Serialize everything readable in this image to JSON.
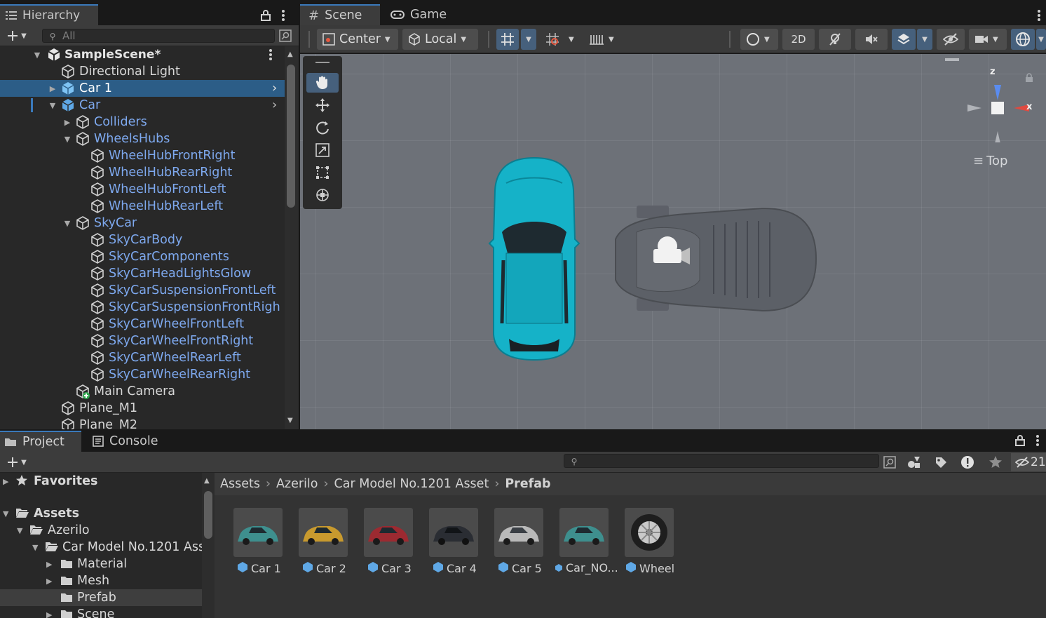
{
  "hierarchy": {
    "tab_label": "Hierarchy",
    "search_placeholder": "All",
    "scene_name": "SampleScene*",
    "items": [
      {
        "label": "Directional Light"
      },
      {
        "label": "Car 1"
      },
      {
        "label": "Car"
      },
      {
        "label": "Colliders"
      },
      {
        "label": "WheelsHubs"
      },
      {
        "label": "WheelHubFrontRight"
      },
      {
        "label": "WheelHubRearRight"
      },
      {
        "label": "WheelHubFrontLeft"
      },
      {
        "label": "WheelHubRearLeft"
      },
      {
        "label": "SkyCar"
      },
      {
        "label": "SkyCarBody"
      },
      {
        "label": "SkyCarComponents"
      },
      {
        "label": "SkyCarHeadLightsGlow"
      },
      {
        "label": "SkyCarSuspensionFrontLeft"
      },
      {
        "label": "SkyCarSuspensionFrontRigh"
      },
      {
        "label": "SkyCarWheelFrontLeft"
      },
      {
        "label": "SkyCarWheelFrontRight"
      },
      {
        "label": "SkyCarWheelRearLeft"
      },
      {
        "label": "SkyCarWheelRearRight"
      },
      {
        "label": "Main Camera"
      },
      {
        "label": "Plane_M1"
      },
      {
        "label": "Plane_M2"
      }
    ]
  },
  "scene": {
    "tab_scene": "Scene",
    "tab_game": "Game",
    "pivot": "Center",
    "space": "Local",
    "mode_2d": "2D",
    "gizmo": {
      "z": "z",
      "x": "x",
      "view": "Top"
    }
  },
  "project": {
    "tab_project": "Project",
    "tab_console": "Console",
    "hidden_count": "21",
    "tree": {
      "favorites": "Favorites",
      "assets": "Assets",
      "azerilo": "Azerilo",
      "car_model": "Car Model No.1201 Ass",
      "material": "Material",
      "mesh": "Mesh",
      "prefab": "Prefab",
      "scene": "Scene"
    },
    "breadcrumb": [
      "Assets",
      "Azerilo",
      "Car Model No.1201 Asset",
      "Prefab"
    ],
    "assets": [
      {
        "name": "Car 1",
        "color": "#3e8f8e"
      },
      {
        "name": "Car 2",
        "color": "#c89a2e"
      },
      {
        "name": "Car 3",
        "color": "#9c2a31"
      },
      {
        "name": "Car 4",
        "color": "#2a2d33"
      },
      {
        "name": "Car 5",
        "color": "#b9b9b9"
      },
      {
        "name": "Car_NO...",
        "color": "#3e8f8e"
      },
      {
        "name": "Wheel",
        "color": "#222222"
      }
    ]
  },
  "colors": {
    "selection": "#2c5d87",
    "prefab_text": "#7ea9ef",
    "car_cyan": "#15b2c8"
  }
}
